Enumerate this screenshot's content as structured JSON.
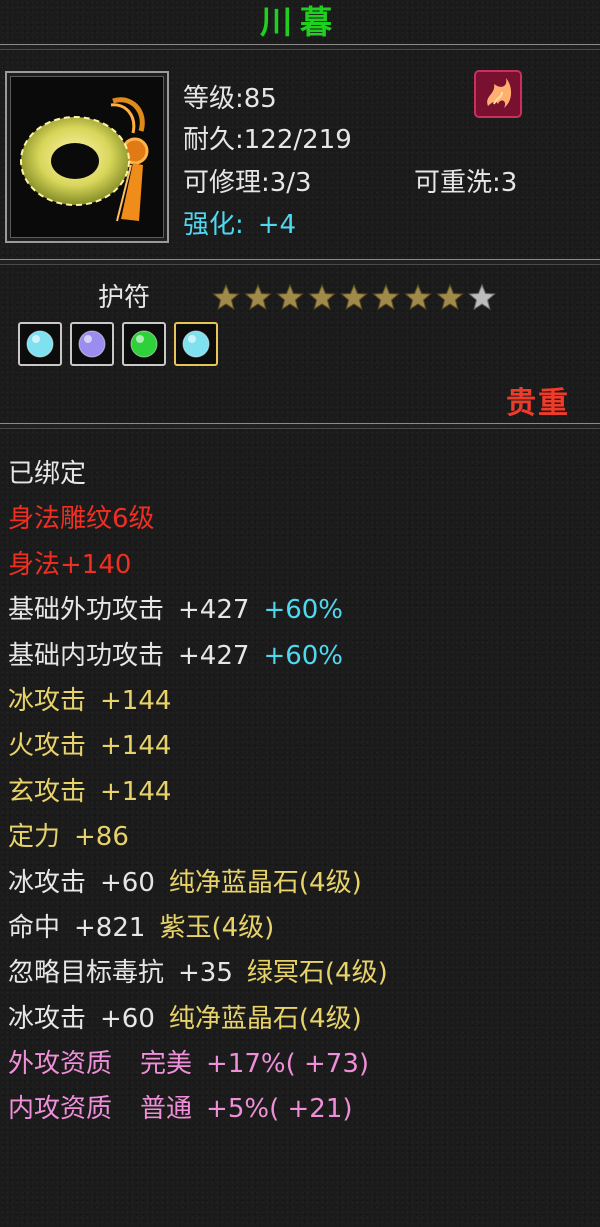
{
  "item": {
    "name": "川暮",
    "level": "等级:85",
    "durability": "耐久:122/219",
    "repairable": "可修理:3/3",
    "rewashable": "可重洗:3",
    "enhance_label": "强化:",
    "enhance_value": "+4",
    "type": "护符",
    "stars_total": 9,
    "stars_filled": 8,
    "rarity": "贵重"
  },
  "gem_slots": [
    {
      "icon": "cyan-gem-icon",
      "color": "#7fe0f0"
    },
    {
      "icon": "purple-gem-icon",
      "color": "#9b8cf0"
    },
    {
      "icon": "green-gem-icon",
      "color": "#2ed13a"
    },
    {
      "icon": "cyan-gem-icon",
      "color": "#7fe0f0"
    }
  ],
  "properties": {
    "bound": "已绑定",
    "carving": "身法雕纹6级",
    "agility": "身法+140",
    "outer_attack": {
      "label": "基础外功攻击",
      "value": "+427",
      "pct": "+60%"
    },
    "inner_attack": {
      "label": "基础内功攻击",
      "value": "+427",
      "pct": "+60%"
    },
    "ice_attack": {
      "label": "冰攻击",
      "value": "+144"
    },
    "fire_attack": {
      "label": "火攻击",
      "value": "+144"
    },
    "mystic_attack": {
      "label": "玄攻击",
      "value": "+144"
    },
    "focus": {
      "label": "定力",
      "value": "+86"
    },
    "gem1": {
      "label": "冰攻击",
      "value": "+60",
      "gem": "纯净蓝晶石(4级)"
    },
    "gem2": {
      "label": "命中",
      "value": "+821",
      "gem": "紫玉(4级)"
    },
    "gem3": {
      "label": "忽略目标毒抗",
      "value": "+35",
      "gem": "绿冥石(4级)"
    },
    "gem4": {
      "label": "冰攻击",
      "value": "+60",
      "gem": "纯净蓝晶石(4级)"
    },
    "apt_outer": {
      "label": "外攻资质",
      "grade": "完美",
      "value": "+17%",
      "extra": "( +73)"
    },
    "apt_inner": {
      "label": "内攻资质",
      "grade": "普通",
      "value": "+5%",
      "extra": "( +21)"
    }
  },
  "colors": {
    "title": "#1fd01f",
    "red": "#ee2f22",
    "cyan": "#4fd8f0",
    "yellow": "#e8d36a",
    "pink": "#ef8fd9",
    "star_filled": "#a08a4a",
    "star_empty": "#bdbdbd"
  }
}
